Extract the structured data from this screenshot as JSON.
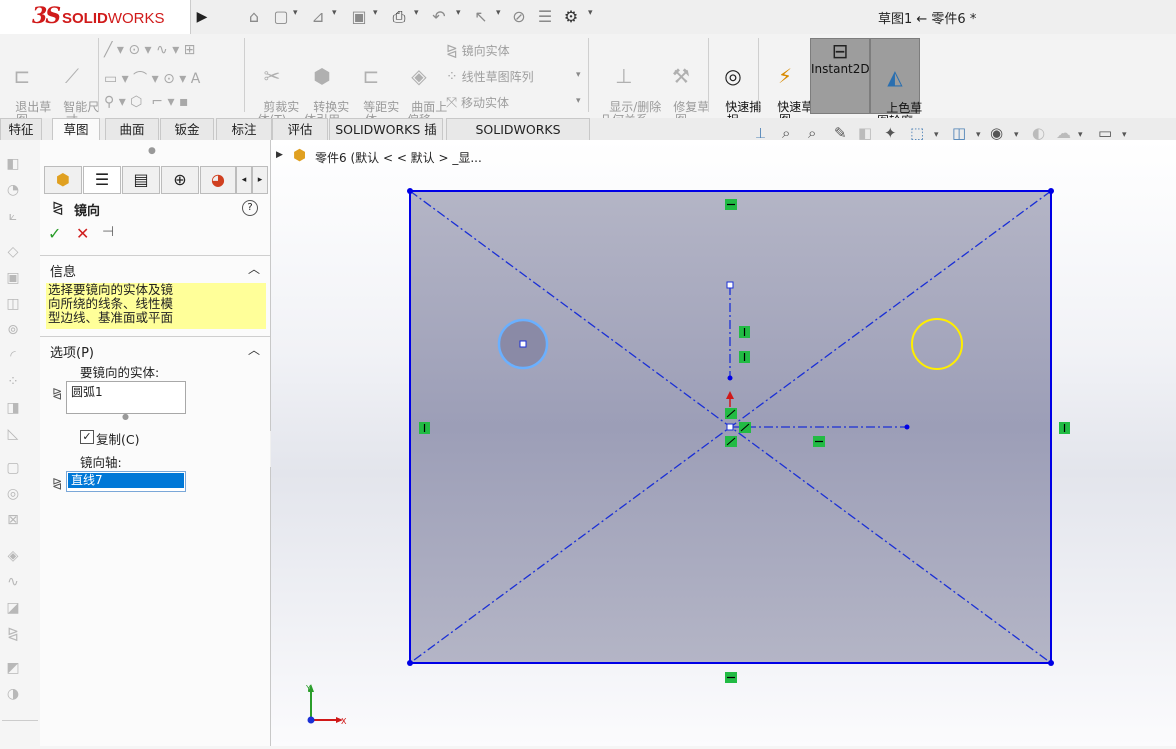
{
  "app": {
    "logo_mark": "3S",
    "logo_text_bold": "SOLID",
    "logo_text": "WORKS",
    "doc_title": "草图1 ← 零件6 *"
  },
  "quick_access": [
    "home-icon",
    "new-doc-icon",
    "open-icon",
    "save-icon",
    "print-icon",
    "undo-icon",
    "select-icon",
    "rebuild-icon",
    "file-props-icon",
    "options-icon"
  ],
  "commands": {
    "exit_sketch": "退出草\n图",
    "smart_dim": "智能尺\n寸",
    "trim": "剪裁实\n体(T)",
    "convert": "转换实\n体引用",
    "offset": "等距实\n体",
    "surface_offset": "曲面上\n偏移",
    "mirror_entities": "镜向实体",
    "linear_pattern": "线性草图阵列",
    "move_entities": "移动实体",
    "display_relations": "显示/删除\n几何关系",
    "repair_sketch": "修复草\n图",
    "quick_snaps": "快速捕\n捉",
    "rapid_sketch": "快速草\n图",
    "instant2d": "Instant2D",
    "shaded_sketch": "上色草\n图轮廓"
  },
  "tabs": [
    "特征",
    "草图",
    "曲面",
    "钣金",
    "标注",
    "评估",
    "SOLIDWORKS 插件",
    "SOLIDWORKS Inspection"
  ],
  "selected_tab": "草图",
  "tree": {
    "part_label": "零件6  (默认 < < 默认 > _显..."
  },
  "property_manager": {
    "title": "镜向",
    "help_icon": "?",
    "info_header": "信息",
    "info_lines": [
      "选择要镜向的实体及镜",
      "向所绕的线条、线性模",
      "型边线、基准面或平面"
    ],
    "options_header": "选项(P)",
    "entities_label": "要镜向的实体:",
    "entities_list": [
      "圆弧1"
    ],
    "copy_label": "复制(C)",
    "copy_checked": true,
    "axis_label": "镜向轴:",
    "axis_value": "直线7"
  },
  "colors": {
    "sketch_blue": "#0000e6",
    "construction_blue": "#1a2fd6",
    "selected_circle": "#6ab0ff",
    "highlight_circle": "#ffee00",
    "relation_green": "#22bb44",
    "info_yellow": "#ffff99",
    "axis_value_bg": "#0078d7"
  }
}
